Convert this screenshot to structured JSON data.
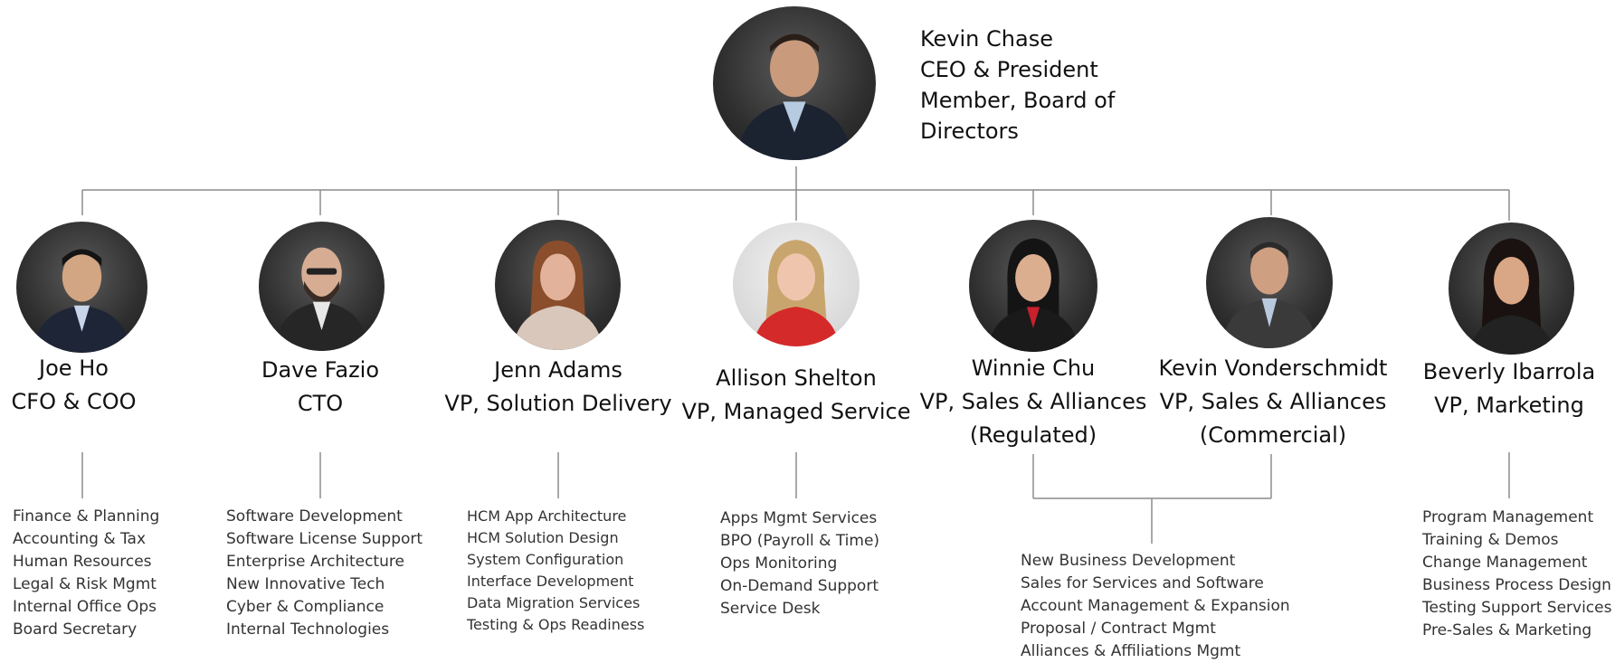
{
  "ceo": {
    "name": "Kevin Chase",
    "title_lines": [
      "CEO & President",
      "Member, Board of",
      "Directors"
    ]
  },
  "executives": [
    {
      "name": "Joe Ho",
      "title_lines": [
        "CFO & COO"
      ],
      "responsibilities": [
        "Finance & Planning",
        "Accounting & Tax",
        "Human Resources",
        "Legal & Risk Mgmt",
        "Internal Office Ops",
        "Board Secretary"
      ]
    },
    {
      "name": "Dave Fazio",
      "title_lines": [
        "CTO"
      ],
      "responsibilities": [
        "Software Development",
        "Software License Support",
        "Enterprise Architecture",
        "New Innovative Tech",
        "Cyber & Compliance",
        "Internal Technologies"
      ]
    },
    {
      "name": "Jenn Adams",
      "title_lines": [
        "VP, Solution Delivery"
      ],
      "responsibilities": [
        "HCM App Architecture",
        "HCM Solution Design",
        "System Configuration",
        "Interface Development",
        "Data Migration Services",
        "Testing & Ops Readiness"
      ]
    },
    {
      "name": "Allison Shelton",
      "title_lines": [
        "VP, Managed Service"
      ],
      "responsibilities": [
        "Apps Mgmt Services",
        "BPO (Payroll & Time)",
        "Ops Monitoring",
        "On-Demand Support",
        "Service Desk"
      ]
    },
    {
      "name": "Winnie Chu",
      "title_lines": [
        "VP, Sales & Alliances",
        "(Regulated)"
      ]
    },
    {
      "name": "Kevin Vonderschmidt",
      "title_lines": [
        "VP, Sales & Alliances",
        "(Commercial)"
      ]
    },
    {
      "name": "Beverly Ibarrola",
      "title_lines": [
        "VP, Marketing"
      ],
      "responsibilities": [
        "Program Management",
        "Training & Demos",
        "Change Management",
        "Business Process Design",
        "Testing Support Services",
        "Pre-Sales & Marketing"
      ]
    }
  ],
  "shared_sales_responsibilities": [
    "New Business Development",
    "Sales for Services and Software",
    "Account Management & Expansion",
    "Proposal / Contract Mgmt",
    "Alliances & Affiliations Mgmt"
  ],
  "colors": {
    "connector": "#8c8c8c",
    "text": "#111111",
    "list_text": "#333333"
  }
}
